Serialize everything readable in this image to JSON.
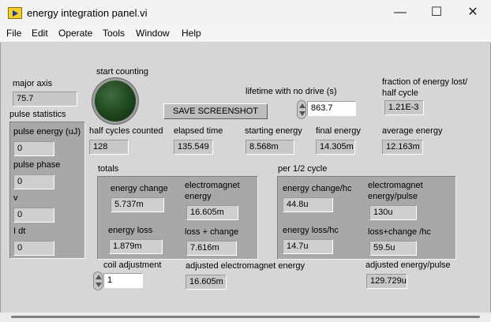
{
  "window": {
    "title": "energy integration panel.vi",
    "minimize": "—",
    "maximize": "☐",
    "close": "✕"
  },
  "menu": [
    "File",
    "Edit",
    "Operate",
    "Tools",
    "Window",
    "Help"
  ],
  "major_axis": {
    "label": "major axis",
    "value": "75.7"
  },
  "start_counting": {
    "label": "start counting"
  },
  "save_button": {
    "label": "SAVE SCREENSHOT"
  },
  "lifetime": {
    "label": "lifetime with no drive (s)",
    "value": "863.7"
  },
  "fraction_lost": {
    "label": "fraction of energy lost/ half cycle",
    "value": "1.21E-3"
  },
  "pulse_statistics": {
    "label": "pulse statistics",
    "pulse_energy": {
      "label": "pulse energy (uJ)",
      "value": "0"
    },
    "pulse_phase": {
      "label": "pulse phase",
      "value": "0"
    },
    "v": {
      "label": "v",
      "value": "0"
    },
    "i_dt": {
      "label": "I dt",
      "value": "0"
    }
  },
  "half_cycles": {
    "label": "half cycles counted",
    "value": "128"
  },
  "elapsed_time": {
    "label": "elapsed time",
    "value": "135.549"
  },
  "starting_energy": {
    "label": "starting energy",
    "value": "8.568m"
  },
  "final_energy": {
    "label": "final energy",
    "value": "14.305m"
  },
  "average_energy": {
    "label": "average energy",
    "value": "12.163m"
  },
  "totals": {
    "label": "totals",
    "energy_change": {
      "label": "energy change",
      "value": "5.737m"
    },
    "electromagnet_energy": {
      "label": "electromagnet energy",
      "value": "16.605m"
    },
    "energy_loss": {
      "label": "energy loss",
      "value": "1.879m"
    },
    "loss_change": {
      "label": "loss + change",
      "value": "7.616m"
    }
  },
  "per_half_cycle": {
    "label": "per 1/2 cycle",
    "energy_change_hc": {
      "label": "energy change/hc",
      "value": "44.8u"
    },
    "electromagnet_pulse": {
      "label": "electromagnet energy/pulse",
      "value": "130u"
    },
    "energy_loss_hc": {
      "label": "energy loss/hc",
      "value": "14.7u"
    },
    "loss_change_hc": {
      "label": "loss+change /hc",
      "value": "59.5u"
    }
  },
  "coil_adjustment": {
    "label": "coil adjustment",
    "value": "1"
  },
  "adjusted_em_energy": {
    "label": "adjusted electromagnet energy",
    "value": "16.605m"
  },
  "adjusted_energy_pulse": {
    "label": "adjusted energy/pulse",
    "value": "129.729u"
  }
}
